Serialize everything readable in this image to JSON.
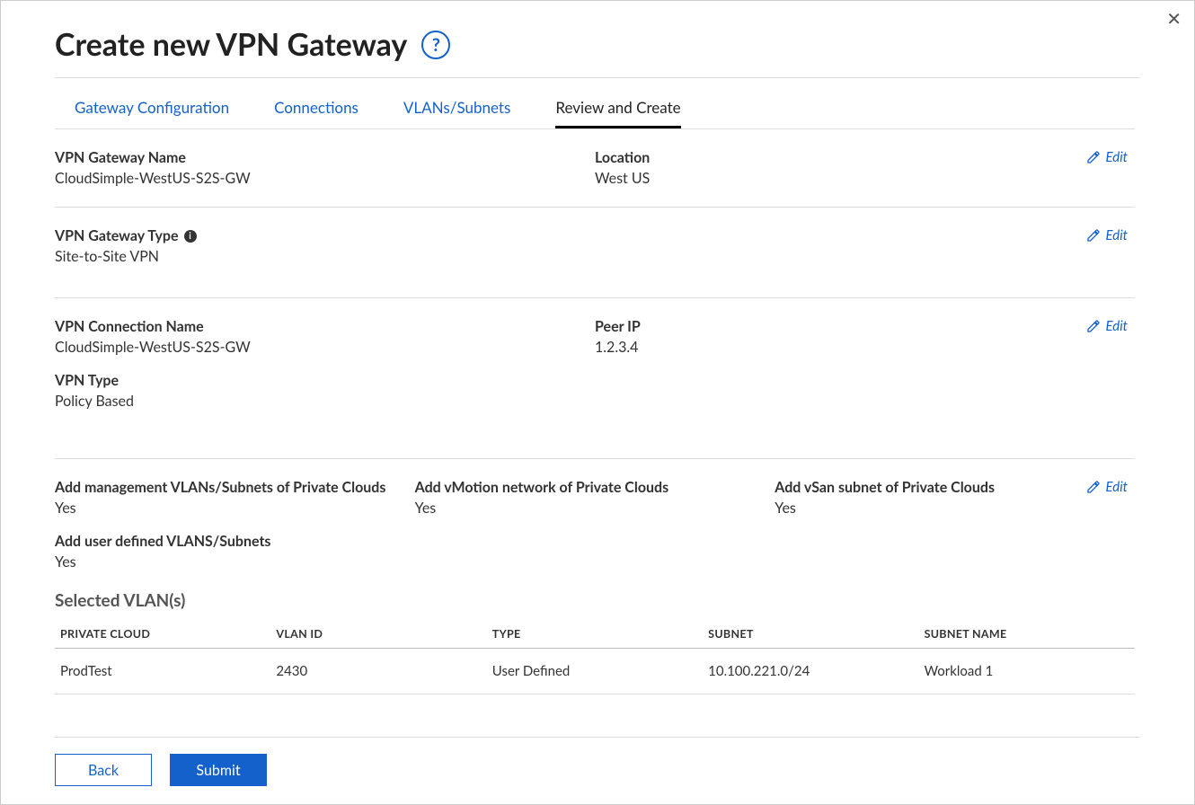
{
  "page": {
    "title": "Create new VPN Gateway",
    "help_tooltip": "?",
    "close": "✕"
  },
  "tabs": [
    {
      "label": "Gateway Configuration",
      "active": false
    },
    {
      "label": "Connections",
      "active": false
    },
    {
      "label": "VLANs/Subnets",
      "active": false
    },
    {
      "label": "Review and Create",
      "active": true
    }
  ],
  "edit_label": "Edit",
  "sections": {
    "gateway": {
      "name_label": "VPN Gateway Name",
      "name_value": "CloudSimple-WestUS-S2S-GW",
      "location_label": "Location",
      "location_value": "West US"
    },
    "gateway_type": {
      "type_label": "VPN Gateway Type",
      "type_value": "Site-to-Site VPN"
    },
    "connection": {
      "conn_name_label": "VPN Connection Name",
      "conn_name_value": "CloudSimple-WestUS-S2S-GW",
      "peer_label": "Peer IP",
      "peer_value": "1.2.3.4",
      "vpn_type_label": "VPN Type",
      "vpn_type_value": "Policy Based"
    },
    "vlans_flags": {
      "mgmt_label": "Add management VLANs/Subnets of Private Clouds",
      "mgmt_value": "Yes",
      "vmotion_label": "Add vMotion network of Private Clouds",
      "vmotion_value": "Yes",
      "vsan_label": "Add vSan subnet of Private Clouds",
      "vsan_value": "Yes",
      "user_label": "Add user defined VLANS/Subnets",
      "user_value": "Yes"
    }
  },
  "selected_vlans": {
    "heading": "Selected VLAN(s)",
    "columns": {
      "private_cloud": "PRIVATE CLOUD",
      "vlan_id": "VLAN ID",
      "type": "TYPE",
      "subnet": "SUBNET",
      "subnet_name": "SUBNET NAME"
    },
    "rows": [
      {
        "private_cloud": "ProdTest",
        "vlan_id": "2430",
        "type": "User Defined",
        "subnet": "10.100.221.0/24",
        "subnet_name": "Workload 1"
      }
    ]
  },
  "footer": {
    "back": "Back",
    "submit": "Submit"
  }
}
